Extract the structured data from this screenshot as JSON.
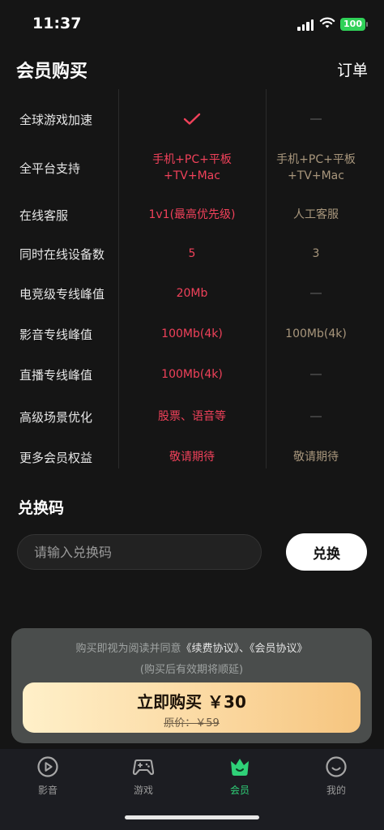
{
  "status_bar": {
    "time": "11:37",
    "battery": "100"
  },
  "header": {
    "title": "会员购买",
    "order_link": "订单"
  },
  "comparison": {
    "rows": [
      {
        "label": "全球游戏加速",
        "premium": "check-icon",
        "standard": "—"
      },
      {
        "label": "全平台支持",
        "premium": "手机+PC+平板\n+TV+Mac",
        "standard": "手机+PC+平板\n+TV+Mac"
      },
      {
        "label": "在线客服",
        "premium": "1v1(最高优先级)",
        "standard": "人工客服"
      },
      {
        "label": "同时在线设备数",
        "premium": "5",
        "standard": "3"
      },
      {
        "label": "电竞级专线峰值",
        "premium": "20Mb",
        "standard": "—"
      },
      {
        "label": "影音专线峰值",
        "premium": "100Mb(4k)",
        "standard": "100Mb(4k)"
      },
      {
        "label": "直播专线峰值",
        "premium": "100Mb(4k)",
        "standard": "—"
      },
      {
        "label": "高级场景优化",
        "premium": "股票、语音等",
        "standard": "—"
      },
      {
        "label": "更多会员权益",
        "premium": "敬请期待",
        "standard": "敬请期待"
      }
    ],
    "colors": {
      "premium": "#f0415a",
      "standard": "#a8967c"
    }
  },
  "redeem": {
    "title": "兑换码",
    "placeholder": "请输入兑换码",
    "button": "兑换"
  },
  "purchase": {
    "agreement_prefix": "购买即视为阅读并同意",
    "agreement_link1": "《续费协议》",
    "agreement_sep": "、",
    "agreement_link2": "《会员协议》",
    "note": "(购买后有效期将顺延)",
    "buy_label": "立即购买 ￥30",
    "original_price": "原价：￥59"
  },
  "tabs": [
    {
      "label": "影音",
      "icon": "play-circle-icon",
      "active": false
    },
    {
      "label": "游戏",
      "icon": "gamepad-icon",
      "active": false
    },
    {
      "label": "会员",
      "icon": "crown-icon",
      "active": true
    },
    {
      "label": "我的",
      "icon": "smile-icon",
      "active": false
    }
  ],
  "accent_color": "#2fd178"
}
